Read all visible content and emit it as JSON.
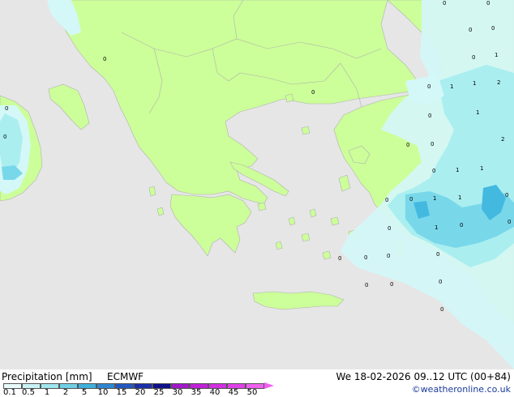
{
  "map": {
    "sea_color": "#e6e6e6",
    "land_color": "#ccff99",
    "border_color": "#b0b0b0",
    "precip_colors": {
      "light": "#d4f7f7",
      "medium": "#aaeef0",
      "heavy": "#78d8ea",
      "strong": "#44b9e0"
    },
    "point_values": [
      "0",
      "0",
      "0",
      "0",
      "1",
      "0",
      "0",
      "1",
      "1",
      "2",
      "0",
      "1",
      "0",
      "0",
      "2",
      "0",
      "1",
      "1",
      "0",
      "0",
      "1",
      "1",
      "0",
      "0",
      "1",
      "0",
      "0",
      "0",
      "0",
      "0",
      "0",
      "0",
      "0",
      "0",
      "0",
      "0",
      "0",
      "0",
      "0"
    ]
  },
  "footer": {
    "title": "Precipitation [mm]",
    "model": "ECMWF",
    "datetime": "We 18-02-2026 09..12 UTC (00+84)",
    "credit": "©weatheronline.co.uk",
    "scale_labels": [
      "0.1",
      "0.5",
      "1",
      "2",
      "5",
      "10",
      "15",
      "20",
      "25",
      "30",
      "35",
      "40",
      "45",
      "50"
    ],
    "scale_colors": [
      "#e8fafa",
      "#c8f2f4",
      "#9fe6ee",
      "#6fd0e6",
      "#3fb0dc",
      "#2e86d0",
      "#2458c0",
      "#1a2fa8",
      "#0f108a",
      "#a018c8",
      "#c020d8",
      "#d030e0",
      "#e040e8",
      "#f060f0"
    ]
  }
}
